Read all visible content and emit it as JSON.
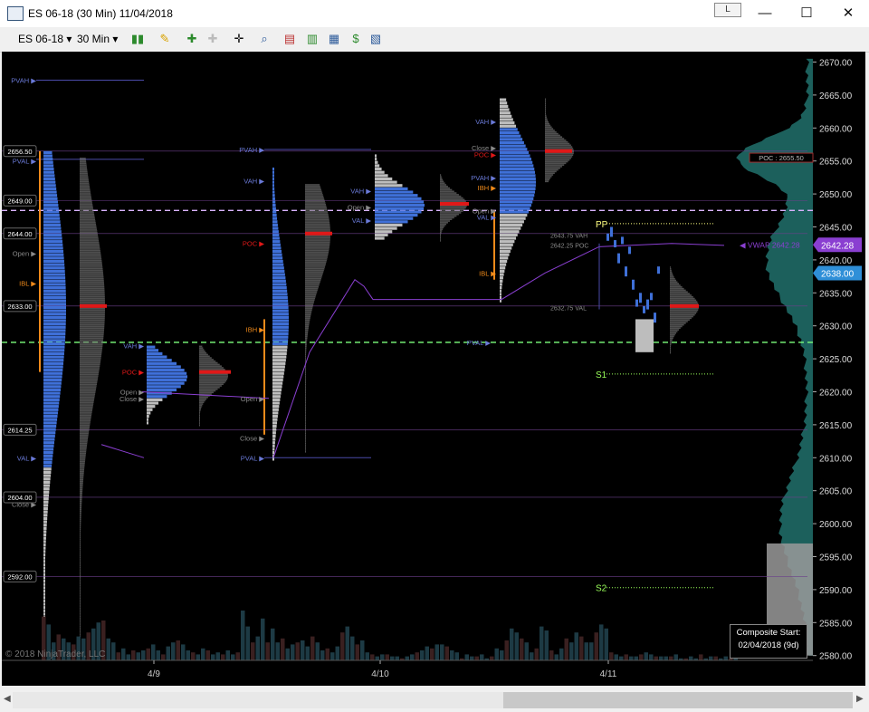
{
  "window": {
    "title": "ES 06-18 (30 Min)  11/04/2018",
    "pin_label": "L",
    "minimize": "—",
    "maximize": "☐",
    "close": "✕"
  },
  "toolbar": {
    "instrument": "ES 06-18",
    "interval": "30 Min"
  },
  "watermark": "© 2018 NinjaTrader, LLC",
  "composite": {
    "line1": "Composite Start:",
    "line2": "02/04/2018 (9d)"
  },
  "price_axis": {
    "labels": [
      "2670.00",
      "2665.00",
      "2660.00",
      "2655.00",
      "2650.00",
      "2645.00",
      "2640.00",
      "2635.00",
      "2630.00",
      "2625.00",
      "2620.00",
      "2615.00",
      "2610.00",
      "2605.00",
      "2600.00",
      "2595.00",
      "2590.00",
      "2585.00",
      "2580.00"
    ],
    "markers": [
      {
        "price": 2642.28,
        "label": "2642.28",
        "color": "#8a3fd1"
      },
      {
        "price": 2638.0,
        "label": "2638.00",
        "color": "#2f8fd8"
      }
    ],
    "poc_tag": "POC : 2655.50",
    "vwap_tag": "◀ VWAP  2642.28"
  },
  "date_labels": [
    "4/9",
    "4/10",
    "4/11"
  ],
  "levels_left": [
    "2656.50",
    "2649.00",
    "2644.00",
    "2633.00",
    "2614.25",
    "2604.00",
    "2592.00"
  ],
  "annotations": {
    "pp": "PP",
    "s1": "S1",
    "s2": "S2",
    "vah": "VAH",
    "val": "VAL",
    "poc": "POC",
    "pvah": "PVAH",
    "pval": "PVAL",
    "ibh": "IBH",
    "ibl": "IBL",
    "open": "Open",
    "close": "Close",
    "vah_price": "2643.75 VAH",
    "val_price": "2632.75 VAL",
    "poc_price": "2642.25 POC"
  },
  "volume_bars": [
    22,
    18,
    9,
    13,
    11,
    9,
    8,
    12,
    11,
    14,
    16,
    19,
    20,
    11,
    9,
    4,
    6,
    3,
    5,
    4,
    5,
    6,
    8,
    5,
    3,
    7,
    9,
    10,
    8,
    5,
    4,
    3,
    6,
    5,
    3,
    4,
    3,
    5,
    3,
    4,
    25,
    17,
    9,
    12,
    21,
    9,
    16,
    9,
    11,
    6,
    8,
    9,
    10,
    7,
    12,
    9,
    5,
    6,
    4,
    7,
    14,
    17,
    12,
    8,
    10,
    4,
    3,
    2,
    3,
    3,
    2,
    2,
    1,
    2,
    3,
    4,
    5,
    7,
    6,
    8,
    8,
    7,
    5,
    4,
    1,
    3,
    2,
    2,
    3,
    1,
    2,
    6,
    5,
    10,
    16,
    14,
    11,
    9,
    4,
    6,
    17,
    15,
    5,
    3,
    6,
    11,
    9,
    14,
    12,
    9,
    9,
    14,
    18,
    16,
    4,
    3,
    2,
    3,
    2,
    2,
    3,
    4,
    3,
    2,
    2,
    2,
    2,
    3,
    1,
    1,
    2,
    1,
    3,
    1,
    2,
    2,
    1,
    2,
    1,
    1
  ]
}
